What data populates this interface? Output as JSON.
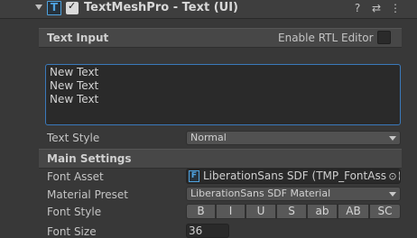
{
  "component": {
    "title": "TextMeshPro - Text (UI)",
    "enabled_check": "✓",
    "type_icon_glyph": "T",
    "header_icons": [
      "help-icon",
      "presets-icon",
      "more-menu-icon"
    ],
    "header_icon_glyphs": [
      "?",
      "⇄",
      "⋮"
    ]
  },
  "text_input": {
    "section_label": "Text Input",
    "rtl_label": "Enable RTL Editor",
    "rtl_checked": false,
    "lines": [
      "New Text",
      "New Text",
      "New Text"
    ],
    "style_label": "Text Style",
    "style_value": "Normal"
  },
  "main_settings": {
    "section_label": "Main Settings",
    "font_asset_label": "Font Asset",
    "font_asset_value": "LiberationSans SDF (TMP_FontAsset)",
    "font_asset_icon_glyph": "F",
    "picker_glyph": "⊙",
    "material_label": "Material Preset",
    "material_value": "LiberationSans SDF Material",
    "font_style_label": "Font Style",
    "font_style_buttons": [
      "B",
      "I",
      "U",
      "S",
      "ab",
      "AB",
      "SC"
    ],
    "font_size_label": "Font Size",
    "font_size_value": "36"
  },
  "colors": {
    "accent_blue": "#4fa3e0",
    "focus_border": "#3a79bb",
    "panel_bg": "#383838"
  }
}
